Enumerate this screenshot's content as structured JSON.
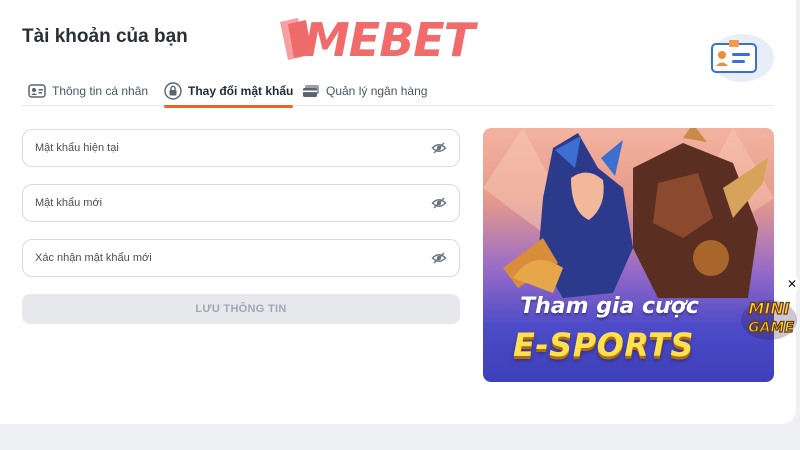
{
  "page": {
    "title": "Tài khoản của bạn"
  },
  "brand": {
    "logo_text": "MEBET",
    "color": "#f26b6b"
  },
  "tabs": [
    {
      "label": "Thông tin cá nhân",
      "icon": "id-card-icon",
      "active": false
    },
    {
      "label": "Thay đổi mật khẩu",
      "icon": "lock-icon",
      "active": true
    },
    {
      "label": "Quản lý ngân hàng",
      "icon": "bank-card-icon",
      "active": false
    }
  ],
  "form": {
    "current_password": {
      "placeholder": "Mật khẩu hiện tại",
      "value": ""
    },
    "new_password": {
      "placeholder": "Mật khẩu mới",
      "value": ""
    },
    "confirm_password": {
      "placeholder": "Xác nhận mật khẩu mới",
      "value": ""
    },
    "save_label": "LƯU THÔNG TIN"
  },
  "banner": {
    "line1": "Tham gia cược",
    "line2": "E-SPORTS"
  },
  "mini_game": {
    "label_line1": "MINI",
    "label_line2": "GAME"
  },
  "colors": {
    "accent": "#f0612b",
    "button_disabled_bg": "#e6e8ec",
    "button_disabled_text": "#a3a8b0"
  }
}
